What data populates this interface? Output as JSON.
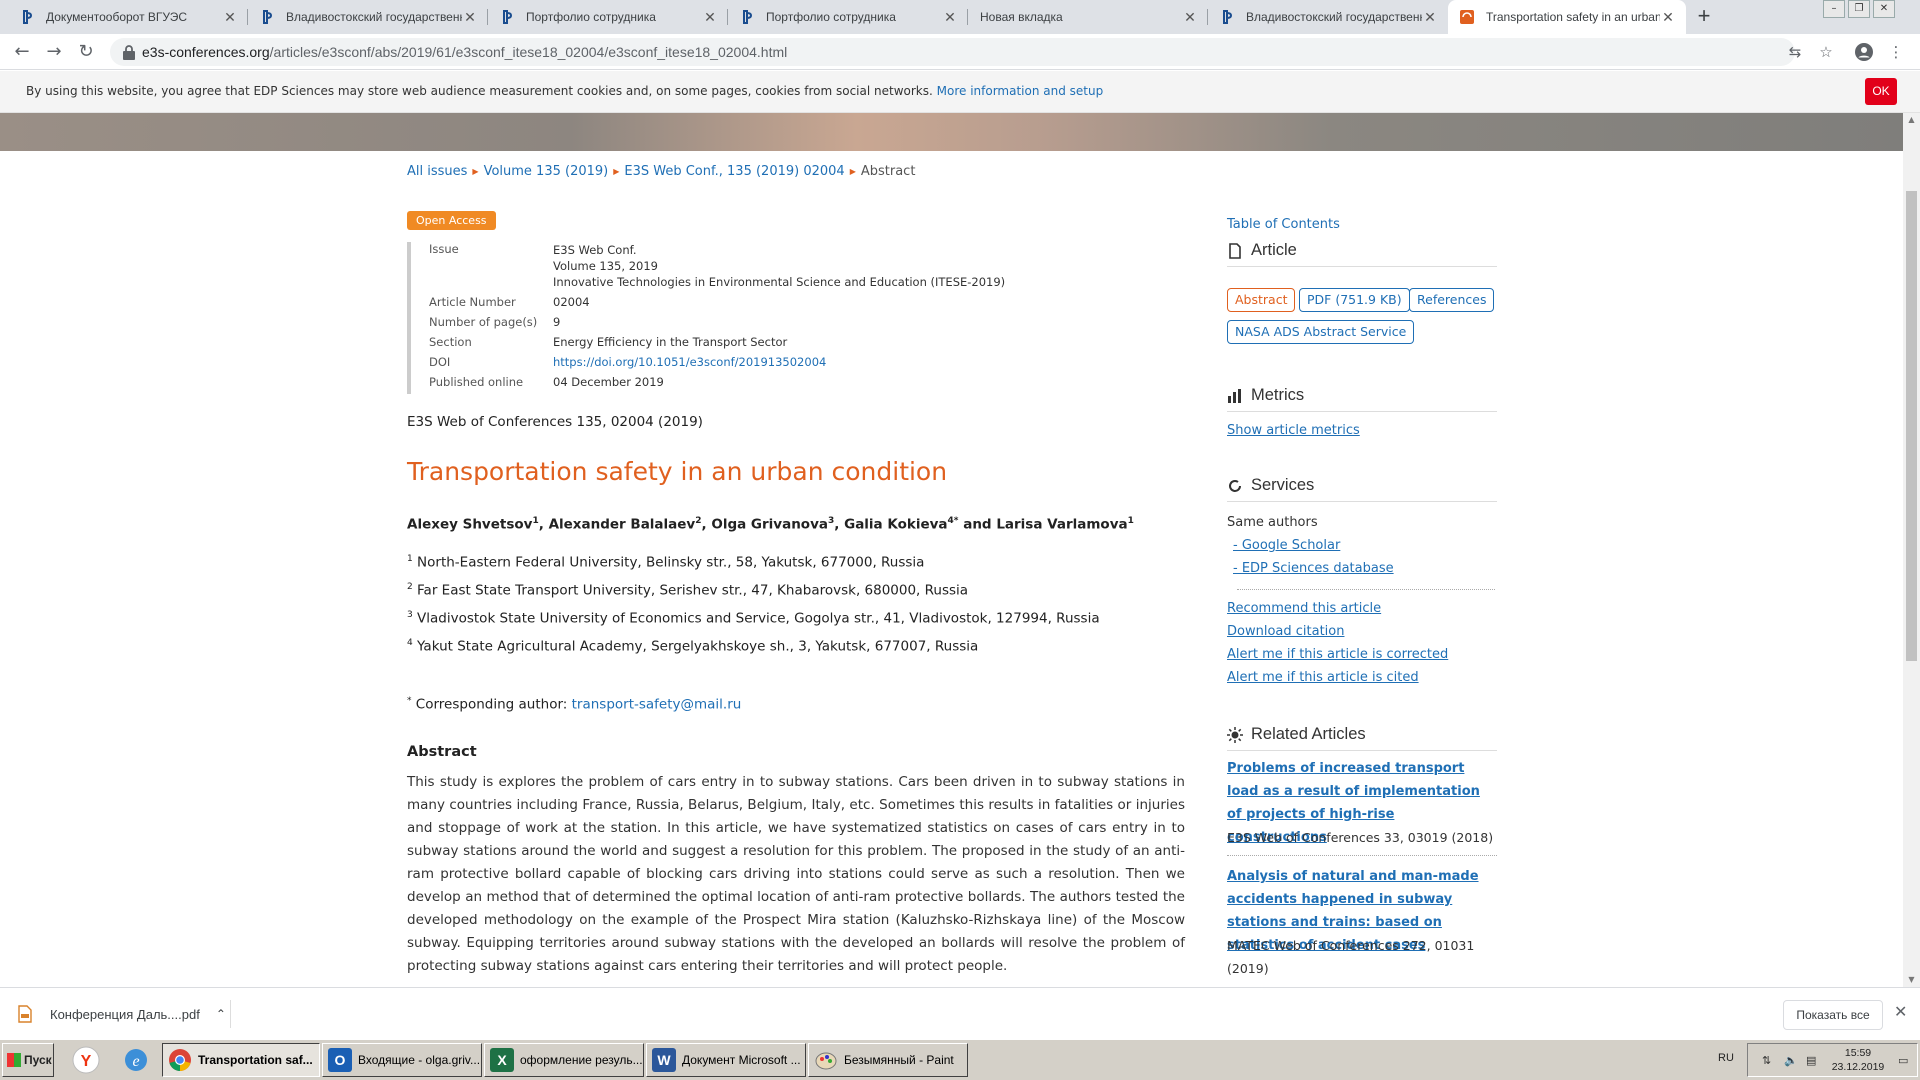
{
  "browser": {
    "tabs": [
      {
        "title": "Документооборот ВГУЭС"
      },
      {
        "title": "Владивостокский государственный"
      },
      {
        "title": "Портфолио сотрудника"
      },
      {
        "title": "Портфолио сотрудника"
      },
      {
        "title": "Новая вкладка"
      },
      {
        "title": "Владивостокский государственный"
      },
      {
        "title": "Transportation safety in an urban co"
      }
    ],
    "new_tab": "+",
    "url_host": "e3s-conferences.org",
    "url_path": "/articles/e3sconf/abs/2019/61/e3sconf_itese18_02004/e3sconf_itese18_02004.html"
  },
  "cookie": {
    "message": "By using this website, you agree that EDP Sciences may store web audience measurement cookies and, on some pages, cookies from social networks.",
    "link": "More information and setup",
    "ok": "OK"
  },
  "breadcrumb": {
    "items": [
      "All issues",
      "Volume 135 (2019)",
      "E3S Web Conf., 135 (2019) 02004"
    ],
    "current": "Abstract"
  },
  "article": {
    "badge": "Open Access",
    "meta": {
      "issue_label": "Issue",
      "issue_lines": [
        "E3S Web Conf.",
        "Volume 135, 2019",
        "Innovative Technologies in Environmental Science and Education (ITESE-2019)"
      ],
      "number_label": "Article Number",
      "number": "02004",
      "pages_label": "Number of page(s)",
      "pages": "9",
      "section_label": "Section",
      "section": "Energy Efficiency in the Transport Sector",
      "doi_label": "DOI",
      "doi": "https://doi.org/10.1051/e3sconf/201913502004",
      "published_label": "Published online",
      "published": "04 December 2019"
    },
    "citation": "E3S Web of Conferences 135, 02004 (2019)",
    "title": "Transportation safety in an urban condition",
    "authors": [
      {
        "name": "Alexey Shvetsov",
        "sup": "1",
        "sep": ", "
      },
      {
        "name": "Alexander Balalaev",
        "sup": "2",
        "sep": ", "
      },
      {
        "name": "Olga Grivanova",
        "sup": "3",
        "sep": ", "
      },
      {
        "name": "Galia Kokieva",
        "sup": "4*",
        "sep": " and "
      },
      {
        "name": "Larisa Varlamova",
        "sup": "1",
        "sep": ""
      }
    ],
    "affiliations": [
      {
        "n": "1",
        "text": "North-Eastern Federal University, Belinsky str., 58, Yakutsk, 677000, Russia"
      },
      {
        "n": "2",
        "text": "Far East State Transport University, Serishev str., 47, Khabarovsk, 680000, Russia"
      },
      {
        "n": "3",
        "text": "Vladivostok State University of Economics and Service, Gogolya str., 41, Vladivostok, 127994, Russia"
      },
      {
        "n": "4",
        "text": "Yakut State Agricultural Academy, Sergelyakhskoye sh., 3, Yakutsk, 677007, Russia"
      }
    ],
    "corresponding_mark": "*",
    "corresponding_label": "Corresponding author:",
    "corresponding_email": "transport-safety@mail.ru",
    "abstract_heading": "Abstract",
    "abstract": "This study is explores the problem of cars entry in to subway stations. Cars been driven in to subway stations in many countries including France, Russia, Belarus, Belgium, Italy, etc. Sometimes this results in fatalities or injuries and stoppage of work at the station. In this article, we have systematized statistics on cases of cars entry in to subway stations around the world and suggest a resolution for this problem. The proposed in the study of an anti-ram protective bollard capable of blocking cars driving into stations could serve as such a resolution. Then we develop an method that of determined the optimal location of anti-ram protective bollards. The authors tested the developed methodology on the example of the Prospect Mira station (Kaluzhsko-Rizhskaya line) of the Moscow subway. Equipping territories around subway stations with the developed an bollards will resolve the problem of protecting subway stations against cars entering their territories and will protect people."
  },
  "sidebar": {
    "toc": "Table of Contents",
    "article_heading": "Article",
    "buttons": [
      "Abstract",
      "PDF (751.9 KB)",
      "References",
      "NASA ADS Abstract Service"
    ],
    "metrics_heading": "Metrics",
    "metrics_link": "Show article metrics",
    "services_heading": "Services",
    "same_authors": "Same authors",
    "same_authors_links": [
      "- Google Scholar",
      "- EDP Sciences database"
    ],
    "service_links": [
      "Recommend this article",
      "Download citation",
      "Alert me if this article is corrected",
      "Alert me if this article is cited"
    ],
    "related_heading": "Related Articles",
    "related": [
      {
        "title": "Problems of increased transport load as a result of implementation of projects of high-rise constructions",
        "source": "E3S Web of Conferences 33, 03019 (2018)"
      },
      {
        "title": "Analysis of natural and man-made accidents happened in subway stations and trains: based on statistics of accident cases",
        "source": "MATEC Web of Conferences 272, 01031 (2019)"
      }
    ]
  },
  "downloads": {
    "file": "Конференция Даль....pdf",
    "show_all": "Показать все"
  },
  "taskbar": {
    "start": "Пуск",
    "buttons": [
      {
        "label": "Transportation saf..."
      },
      {
        "label": "Входящие - olga.griv..."
      },
      {
        "label": "оформление резуль..."
      },
      {
        "label": "Документ Microsoft ..."
      },
      {
        "label": "Безымянный - Paint"
      }
    ],
    "lang": "RU",
    "time": "15:59",
    "date": "23.12.2019"
  },
  "colors": {
    "accent": "#e0601f",
    "link": "#1f6fb5",
    "cookie_ok": "#e2001a"
  }
}
